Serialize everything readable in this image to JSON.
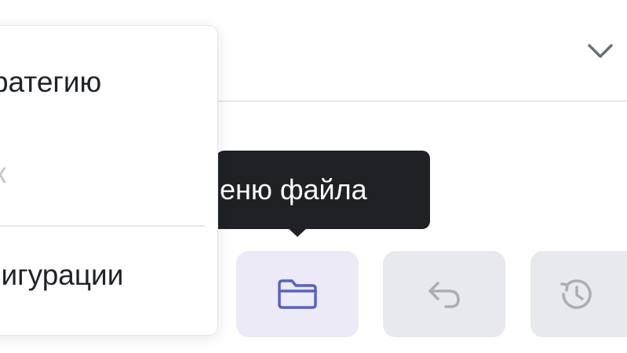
{
  "header": {
    "select_icon": "chevron-down-icon"
  },
  "menu": {
    "items": [
      {
        "label": "тратегию"
      },
      {
        "label": "ак"
      },
      {
        "label": "фигурации"
      }
    ]
  },
  "tooltip": {
    "text": "еню файла"
  },
  "toolbar": {
    "buttons": [
      {
        "icon": "folder-icon",
        "state": "active"
      },
      {
        "icon": "undo-icon",
        "state": "disabled"
      },
      {
        "icon": "history-icon",
        "state": "disabled"
      }
    ]
  },
  "colors": {
    "accent": "#5b5fc7",
    "accent_bg": "#ebeaf6",
    "disabled_bg": "#e7e9ec",
    "disabled_icon": "#a9aeb5",
    "tooltip_bg": "#1f2125",
    "text": "#1f2329",
    "placeholder": "#c3c7cd"
  }
}
